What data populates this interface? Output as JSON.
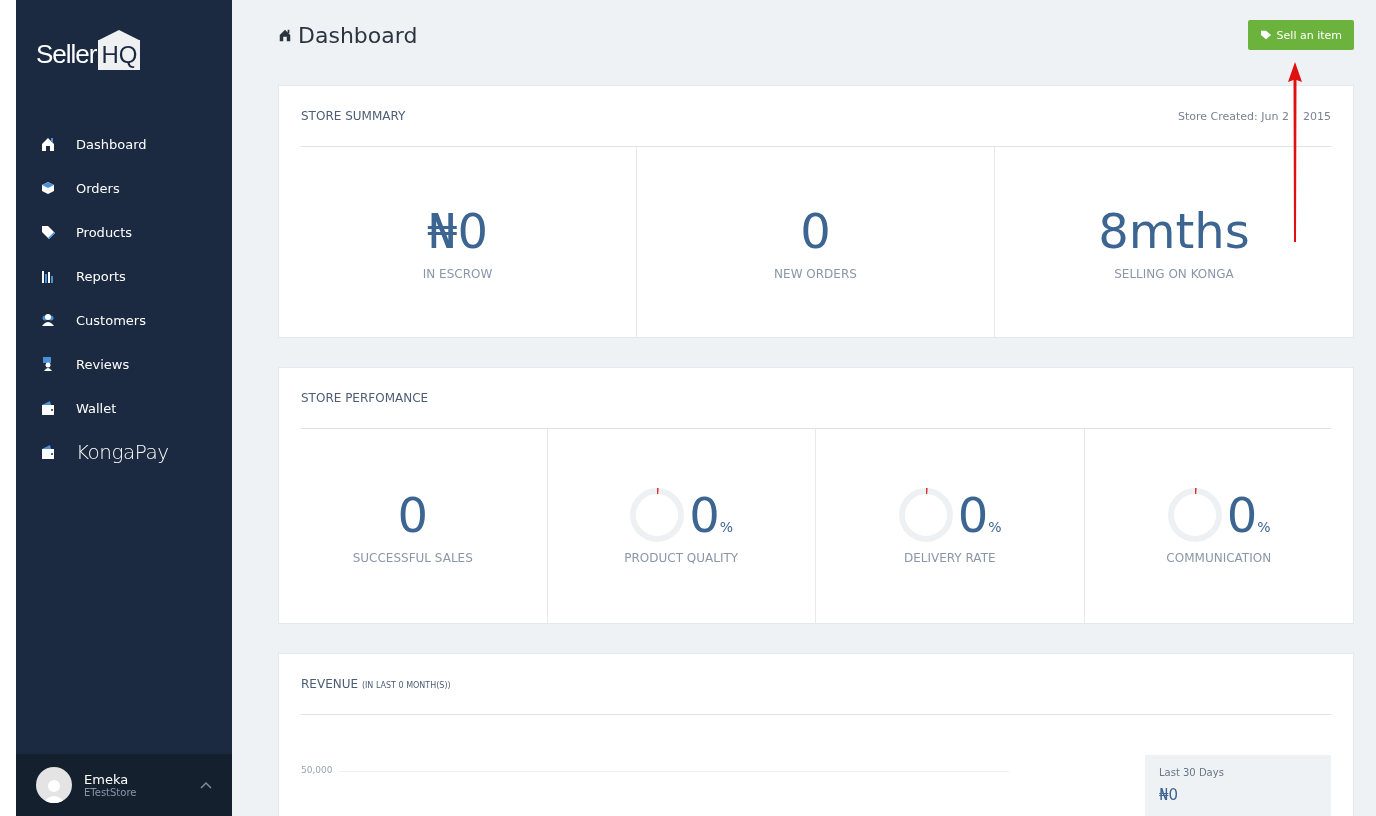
{
  "sidebar": {
    "logo": {
      "word": "Seller",
      "badge": "HQ"
    },
    "items": [
      {
        "label": "Dashboard",
        "kind": "normal"
      },
      {
        "label": "Orders",
        "kind": "normal"
      },
      {
        "label": "Products",
        "kind": "normal"
      },
      {
        "label": "Reports",
        "kind": "normal"
      },
      {
        "label": "Customers",
        "kind": "normal"
      },
      {
        "label": "Reviews",
        "kind": "normal"
      },
      {
        "label": "Wallet",
        "kind": "normal"
      },
      {
        "label": "KongaPay",
        "kind": "brand"
      }
    ],
    "user": {
      "name": "Emeka",
      "store": "ETestStore"
    }
  },
  "header": {
    "title": "Dashboard",
    "button": "Sell an item"
  },
  "summary": {
    "title": "STORE SUMMARY",
    "created": [
      "Store Created: Jun 2",
      "2015"
    ],
    "stats": [
      {
        "value": "₦0",
        "label": "IN ESCROW"
      },
      {
        "value": "0",
        "label": "NEW ORDERS"
      },
      {
        "value": "8mths",
        "label": "SELLING ON KONGA"
      }
    ]
  },
  "performance": {
    "title": "STORE PERFOMANCE",
    "stats": [
      {
        "kind": "number",
        "value": "0",
        "label": "SUCCESSFUL SALES"
      },
      {
        "kind": "gauge",
        "value": "0",
        "unit": "%",
        "level": 0,
        "label": "PRODUCT QUALITY"
      },
      {
        "kind": "gauge",
        "value": "0",
        "unit": "%",
        "level": 0,
        "label": "DELIVERY RATE"
      },
      {
        "kind": "gauge",
        "value": "0",
        "unit": "%",
        "level": 0,
        "label": "COMMUNICATION"
      }
    ]
  },
  "revenue": {
    "title": "REVENUE",
    "subtitle": "(IN LAST 0 MONTH(S))",
    "tick": "50,000",
    "period": {
      "label": "Last 30 Days",
      "value": "₦0"
    }
  }
}
